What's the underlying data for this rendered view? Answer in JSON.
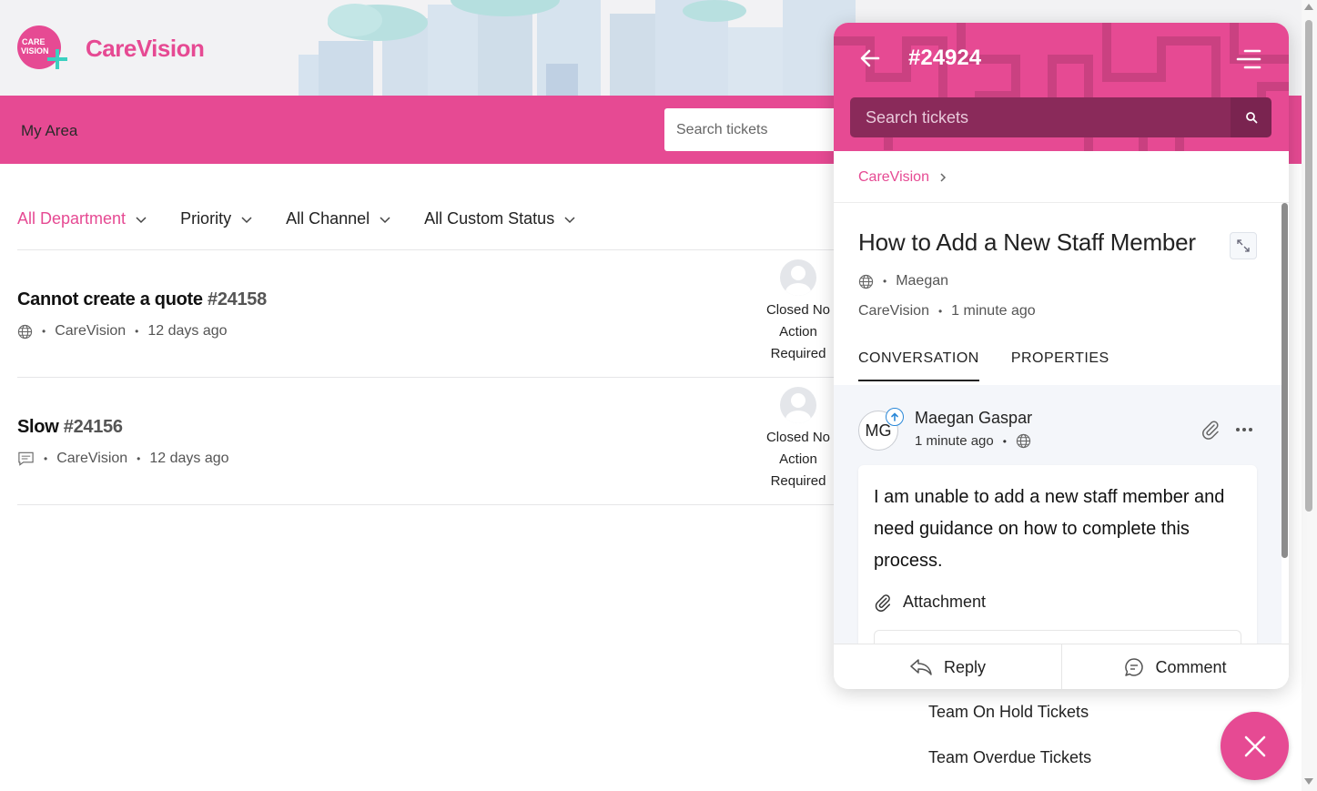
{
  "brand": {
    "name": "CareVision",
    "logo_text_top": "CARE",
    "logo_text_bottom": "VISION"
  },
  "nav": {
    "my_area": "My Area",
    "search_placeholder": "Search tickets"
  },
  "filters": [
    {
      "label": "All Department",
      "active": true
    },
    {
      "label": "Priority",
      "active": false
    },
    {
      "label": "All Channel",
      "active": false
    },
    {
      "label": "All Custom Status",
      "active": false
    }
  ],
  "tickets": [
    {
      "title": "Cannot create a quote",
      "number": "#24158",
      "channel_icon": "globe-icon",
      "brand": "CareVision",
      "age": "12 days ago",
      "status": "Closed No Action Required"
    },
    {
      "title": "Slow",
      "number": "#24156",
      "channel_icon": "chat-icon",
      "brand": "CareVision",
      "age": "12 days ago",
      "status": "Closed No Action Required"
    }
  ],
  "team_links": [
    "Team On Hold Tickets",
    "Team Overdue Tickets"
  ],
  "panel": {
    "ticket_number": "#24924",
    "search_placeholder": "Search tickets",
    "breadcrumb": "CareVision",
    "title": "How to Add a New Staff Member",
    "requester": "Maegan",
    "brand": "CareVision",
    "age": "1 minute ago",
    "tabs": [
      {
        "label": "CONVERSATION",
        "active": true
      },
      {
        "label": "PROPERTIES",
        "active": false
      }
    ],
    "message": {
      "author_initials": "MG",
      "author": "Maegan Gaspar",
      "age": "1 minute ago",
      "body": "I am unable to add a new staff member and need guidance on how to complete this process.",
      "attachment_label": "Attachment"
    },
    "actions": {
      "reply": "Reply",
      "comment": "Comment"
    }
  },
  "colors": {
    "brand_pink": "#e64a93",
    "header_bg": "#f2f2f4",
    "dark_pink": "#8a2a5a"
  }
}
